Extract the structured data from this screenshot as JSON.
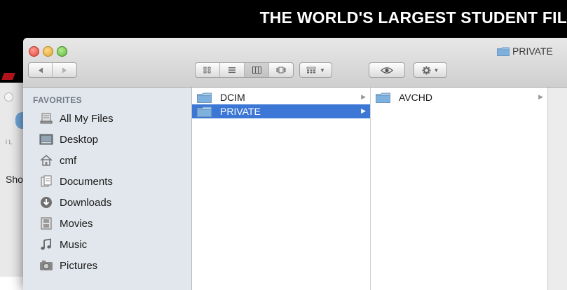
{
  "background": {
    "banner_text": "THE WORLD'S LARGEST STUDENT FIL",
    "partial_left_text": "Sho",
    "partial_tick_text": "l  L"
  },
  "window": {
    "title": "PRIVATE",
    "title_icon": "folder-icon",
    "toolbar": {
      "back_icon": "back-arrow-icon",
      "forward_icon": "forward-arrow-icon",
      "view_modes": [
        "icon-view-icon",
        "list-view-icon",
        "column-view-icon",
        "cover-flow-icon"
      ],
      "active_view": "column-view-icon",
      "arrange_icon": "arrange-grid-icon",
      "quicklook_icon": "eye-icon",
      "action_icon": "gear-icon"
    }
  },
  "sidebar": {
    "section_label": "FAVORITES",
    "items": [
      {
        "label": "All My Files",
        "icon": "all-files-icon"
      },
      {
        "label": "Desktop",
        "icon": "desktop-icon"
      },
      {
        "label": "cmf",
        "icon": "home-icon"
      },
      {
        "label": "Documents",
        "icon": "documents-icon"
      },
      {
        "label": "Downloads",
        "icon": "downloads-icon"
      },
      {
        "label": "Movies",
        "icon": "movies-icon"
      },
      {
        "label": "Music",
        "icon": "music-icon"
      },
      {
        "label": "Pictures",
        "icon": "pictures-icon"
      }
    ]
  },
  "columns": [
    {
      "items": [
        {
          "label": "DCIM",
          "selected": false
        },
        {
          "label": "PRIVATE",
          "selected": true
        }
      ]
    },
    {
      "items": [
        {
          "label": "AVCHD",
          "selected": false
        }
      ]
    }
  ],
  "colors": {
    "selection": "#3c77d6",
    "sidebar_bg": "#e2e7ed",
    "folder_blue": "#7fb1df"
  }
}
